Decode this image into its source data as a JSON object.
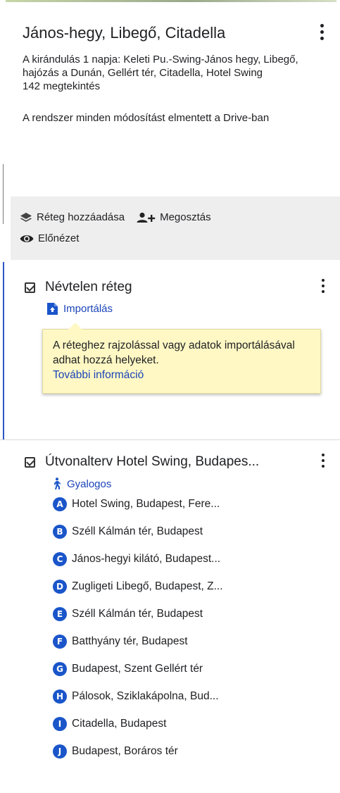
{
  "map": {
    "title": "János-hegy, Libegő, Citadella",
    "description": "A kirándulás 1 napja: Keleti Pu.-Swing-János hegy, Libegő, hajózás a Dunán, Gellért tér, Citadella, Hotel Swing",
    "views": "142 megtekintés",
    "saved_status": "A rendszer minden módosítást elmentett a Drive-ban"
  },
  "toolbar": {
    "add_layer_label": "Réteg hozzáadása",
    "share_label": "Megosztás",
    "preview_label": "Előnézet"
  },
  "layers": [
    {
      "title": "Névtelen réteg",
      "import_label": "Importálás",
      "tooltip_text": "A réteghez rajzolással vagy adatok importálásával adhat hozzá helyeket.",
      "tooltip_link": "További információ"
    },
    {
      "title": "Útvonalterv Hotel Swing, Budapes...",
      "mode_label": "Gyalogos",
      "stops": [
        {
          "letter": "A",
          "label": "Hotel Swing, Budapest, Fere..."
        },
        {
          "letter": "B",
          "label": "Széll Kálmán tér, Budapest"
        },
        {
          "letter": "C",
          "label": "János-hegyi kilátó, Budapest..."
        },
        {
          "letter": "D",
          "label": "Zugligeti Libegő, Budapest, Z..."
        },
        {
          "letter": "E",
          "label": "Széll Kálmán tér, Budapest"
        },
        {
          "letter": "F",
          "label": "Batthyány tér, Budapest"
        },
        {
          "letter": "G",
          "label": "Budapest, Szent Gellért tér"
        },
        {
          "letter": "H",
          "label": "Pálosok, Sziklakápolna, Bud..."
        },
        {
          "letter": "I",
          "label": "Citadella, Budapest"
        },
        {
          "letter": "J",
          "label": "Budapest, Boráros tér"
        }
      ]
    }
  ],
  "colors": {
    "accent": "#1a55c9",
    "link": "#1a44b8",
    "tooltip_bg": "#fff8c4",
    "toolbar_bg": "#eeeeee"
  },
  "icons": {
    "kebab": "more-vert-icon",
    "add_layer": "layers-icon",
    "share": "person-add-icon",
    "preview": "eye-icon",
    "import": "import-icon",
    "walk": "walking-icon"
  }
}
